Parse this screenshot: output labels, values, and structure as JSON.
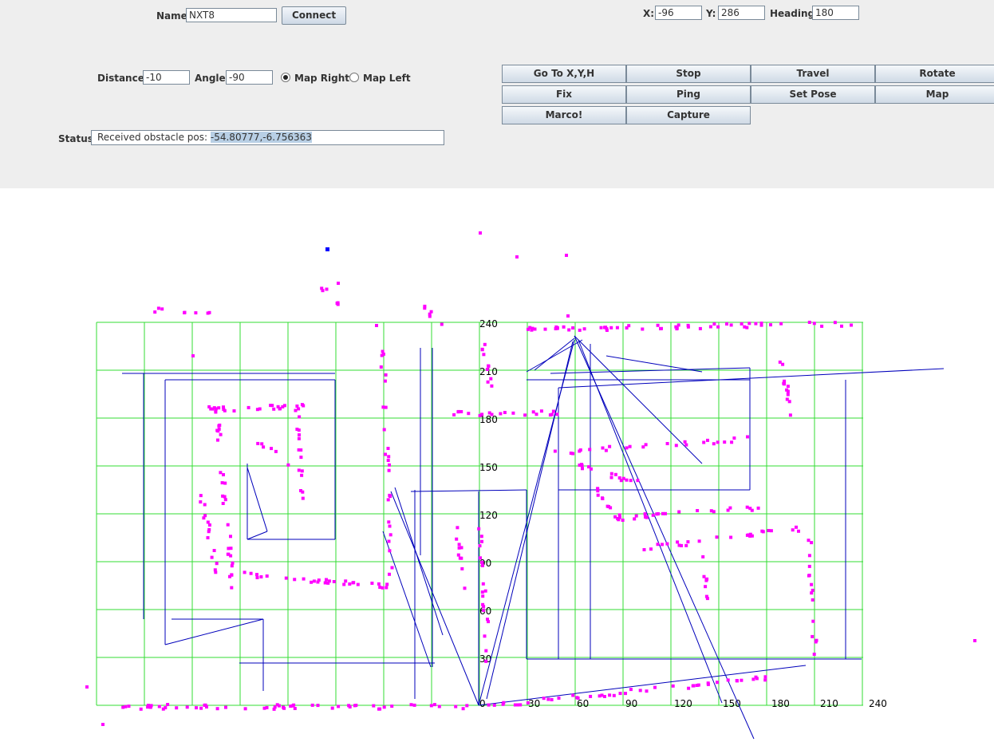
{
  "connection": {
    "name_label": "Name",
    "name_value": "NXT8",
    "connect_label": "Connect"
  },
  "pose": {
    "x_label": "X:",
    "x_value": "-96",
    "y_label": "Y:",
    "y_value": "286",
    "heading_label": "Heading:",
    "heading_value": "180"
  },
  "move": {
    "distance_label": "Distance:",
    "distance_value": "-10",
    "angle_label": "Angle:",
    "angle_value": "-90",
    "map_right_label": "Map Right",
    "map_right_selected": true,
    "map_left_label": "Map Left",
    "map_left_selected": false
  },
  "buttons": [
    {
      "name": "go-to-xyh-button",
      "label": "Go To X,Y,H"
    },
    {
      "name": "stop-button",
      "label": "Stop"
    },
    {
      "name": "travel-button",
      "label": "Travel"
    },
    {
      "name": "rotate-button",
      "label": "Rotate"
    },
    {
      "name": "fix-button",
      "label": "Fix"
    },
    {
      "name": "ping-button",
      "label": "Ping"
    },
    {
      "name": "set-pose-button",
      "label": "Set Pose"
    },
    {
      "name": "map-button",
      "label": "Map"
    },
    {
      "name": "marco-button",
      "label": "Marco!"
    },
    {
      "name": "capture-button",
      "label": "Capture"
    }
  ],
  "status": {
    "label": "Status",
    "text_plain": "Received obstacle pos: ",
    "text_selected": "-54.80777,-6.756363"
  },
  "map": {
    "x_ticks": [
      "0",
      "30",
      "60",
      "90",
      "120",
      "150",
      "180",
      "210",
      "240"
    ],
    "y_ticks": [
      "30",
      "60",
      "90",
      "120",
      "150",
      "180",
      "210",
      "240"
    ],
    "colors": {
      "grid": "#33dd33",
      "obstacle": "#ff00ff",
      "path": "#0000bb",
      "robot": "#0000ff"
    }
  }
}
